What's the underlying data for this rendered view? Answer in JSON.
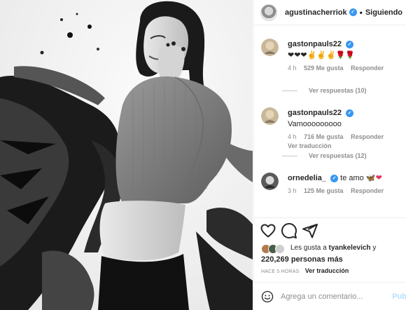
{
  "post": {
    "author": "agustinacherriok",
    "follow_status": "Siguiendo",
    "separator": "•"
  },
  "comments": [
    {
      "user": "gastonpauls22",
      "verified": true,
      "text": "❤❤❤✌✌✌🌹🌹",
      "time": "4 h",
      "likes": "529 Me gusta",
      "reply": "Responder",
      "translate": "",
      "view_replies": "Ver respuestas (10)"
    },
    {
      "user": "gastonpauls22",
      "verified": true,
      "text": "Vamooooooooo",
      "time": "4 h",
      "likes": "716 Me gusta",
      "reply": "Responder",
      "translate": "Ver traducción",
      "view_replies": "Ver respuestas (12)"
    },
    {
      "user": "ornedelia_",
      "verified": true,
      "text": "te amo",
      "time": "3 h",
      "likes": "125 Me gusta",
      "reply": "Responder",
      "translate": "",
      "view_replies": ""
    }
  ],
  "likes": {
    "prefix": "Les gusta a",
    "user": "tyankelevich",
    "conj": "y",
    "count": "220,269 personas más"
  },
  "timestamp": {
    "ago": "HACE 5 HORAS",
    "translate": "Ver traducción"
  },
  "comment_box": {
    "placeholder": "Agrega un comentario...",
    "post_label": "Pub"
  },
  "icons": {
    "like": "heart-outline-icon",
    "comment": "comment-bubble-icon",
    "share": "paper-plane-icon",
    "emoji": "smiley-icon",
    "verified": "verified-badge-icon"
  },
  "colors": {
    "verified": "#3897f0",
    "muted": "#8e8e8e",
    "post_disabled": "#b2dffc",
    "heart_emoji": "#ed1f3c"
  }
}
